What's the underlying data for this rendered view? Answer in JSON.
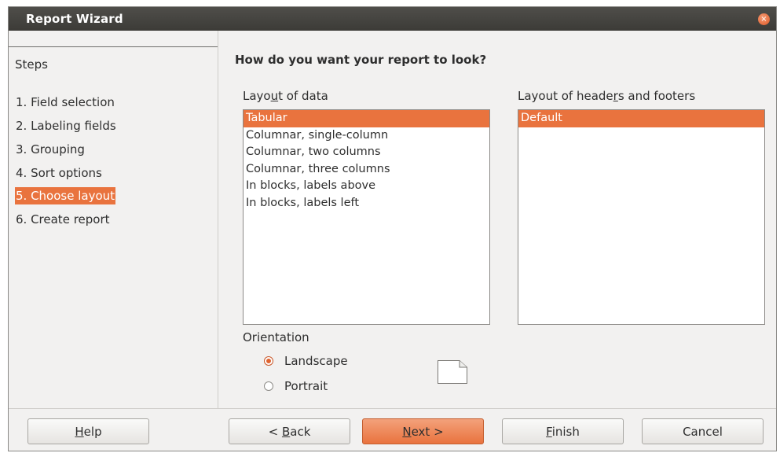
{
  "window": {
    "title": "Report Wizard",
    "close_glyph": "×"
  },
  "steps": {
    "header": "Steps",
    "items": [
      {
        "label": "1. Field selection",
        "active": false
      },
      {
        "label": "2. Labeling fields",
        "active": false
      },
      {
        "label": "3. Grouping",
        "active": false
      },
      {
        "label": "4. Sort options",
        "active": false
      },
      {
        "label": "5. Choose layout",
        "active": true
      },
      {
        "label": "6. Create report",
        "active": false
      }
    ]
  },
  "main": {
    "question": "How do you want your report to look?",
    "layout_of_data": {
      "label_pre": "Layo",
      "label_mn": "u",
      "label_post": "t of data",
      "items": [
        "Tabular",
        "Columnar, single-column",
        "Columnar, two columns",
        "Columnar, three columns",
        "In blocks, labels above",
        "In blocks, labels left"
      ],
      "selected": "Tabular"
    },
    "layout_headers_footers": {
      "label_pre": "Layout of heade",
      "label_mn": "r",
      "label_post": "s and footers",
      "items": [
        "Default"
      ],
      "selected": "Default"
    },
    "orientation": {
      "label": "Orientation",
      "landscape": "Landscape",
      "portrait": "Portrait",
      "selected": "Landscape"
    }
  },
  "buttons": {
    "help": {
      "mn": "H",
      "rest": "elp"
    },
    "back": {
      "pre": "< ",
      "mn": "B",
      "rest": "ack"
    },
    "next": {
      "mn": "N",
      "rest": "ext >"
    },
    "finish": {
      "mn": "F",
      "rest": "inish"
    },
    "cancel": "Cancel"
  },
  "colors": {
    "accent": "#e9733e",
    "titlebar": "#3c3b37",
    "dialog_bg": "#f2f1f0"
  }
}
